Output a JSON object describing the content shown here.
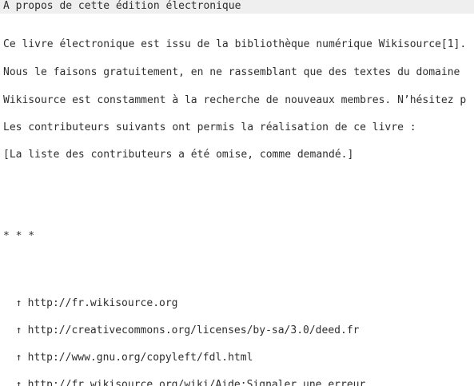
{
  "header": {
    "title": "A propos de cette édition électronique"
  },
  "paragraphs": [
    "Ce livre électronique est issu de la bibliothèque numérique Wikisource[1].",
    "Nous le faisons gratuitement, en ne rassemblant que des textes du domaine",
    "Wikisource est constamment à la recherche de nouveaux membres. N’hésitez p",
    "Les contributeurs suivants ont permis la réalisation de ce livre :",
    "[La liste des contributeurs a été omise, comme demandé.]"
  ],
  "separator": "* * *",
  "links": [
    {
      "arrow": "↑",
      "url": "http://fr.wikisource.org"
    },
    {
      "arrow": "↑",
      "url": "http://creativecommons.org/licenses/by-sa/3.0/deed.fr"
    },
    {
      "arrow": "↑",
      "url": "http://www.gnu.org/copyleft/fdl.html"
    },
    {
      "arrow": "↑",
      "url": "http://fr.wikisource.org/wiki/Aide:Signaler_une_erreur"
    }
  ],
  "colors": {
    "text": "#2e2e2e",
    "header_background": "#efefef",
    "page_background": "#ffffff"
  }
}
